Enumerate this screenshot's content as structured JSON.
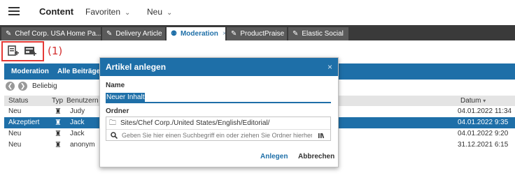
{
  "header": {
    "title": "Content",
    "menus": [
      {
        "label": "Favoriten"
      },
      {
        "label": "Neu"
      }
    ]
  },
  "tabs": [
    {
      "label": "Chef Corp. USA Home Pa...",
      "icon": "pencil-icon",
      "active": false
    },
    {
      "label": "Delivery Article",
      "icon": "pencil-icon",
      "active": false
    },
    {
      "label": "Moderation",
      "icon": "moderation-icon",
      "active": true,
      "close": "×"
    },
    {
      "label": "ProductPraise",
      "icon": "pencil-icon",
      "active": false
    },
    {
      "label": "Elastic Social",
      "icon": "pencil-icon",
      "active": false
    }
  ],
  "annotation": "(1)",
  "subnav": {
    "items": [
      "Moderation",
      "Alle Beiträge"
    ]
  },
  "filter": {
    "label": "Beliebig"
  },
  "table": {
    "headers": {
      "status": "Status",
      "type": "Typ",
      "user": "Benutzern",
      "date": "Datum"
    },
    "rows": [
      {
        "status": "Neu",
        "user": "Judy",
        "date": "04.01.2022 11:34",
        "selected": false
      },
      {
        "status": "Akzeptiert",
        "user": "Jack",
        "date": "04.01.2022 9:35",
        "selected": true
      },
      {
        "status": "Neu",
        "user": "Jack",
        "date": "04.01.2022 9:20",
        "selected": false
      },
      {
        "status": "Neu",
        "user": "anonym",
        "date": "31.12.2021 6:15",
        "selected": false
      }
    ]
  },
  "dialog": {
    "title": "Artikel anlegen",
    "close": "×",
    "name_label": "Name",
    "name_value": "Neuer Inhalt",
    "folder_label": "Ordner",
    "folder_path": "Sites/Chef Corp./United States/English/Editorial/",
    "search_placeholder": "Geben Sie hier einen Suchbegriff ein oder ziehen Sie Ordner hierher.",
    "confirm": "Anlegen",
    "cancel": "Abbrechen"
  },
  "colors": {
    "accent": "#1e6fa8",
    "tabbar": "#3a3a3a",
    "highlight": "#e53935"
  }
}
